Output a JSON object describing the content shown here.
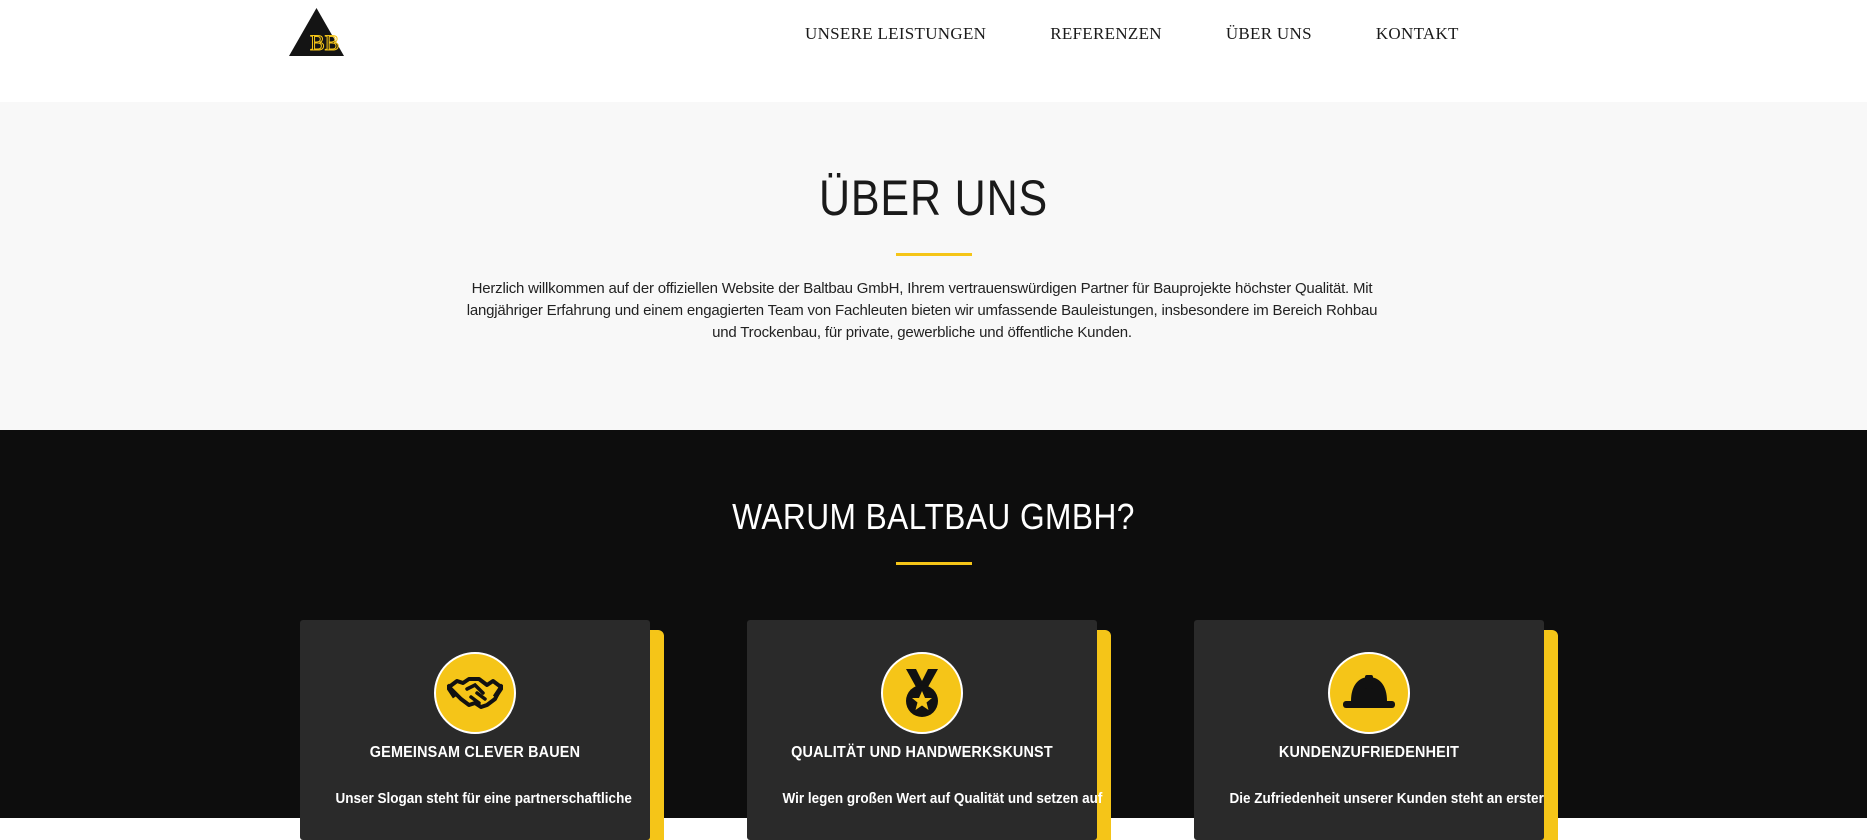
{
  "header": {
    "logo_label": "BB",
    "nav": [
      {
        "label": "UNSERE LEISTUNGEN"
      },
      {
        "label": "REFERENZEN"
      },
      {
        "label": "ÜBER UNS"
      },
      {
        "label": "KONTAKT"
      }
    ]
  },
  "about": {
    "title": "ÜBER UNS",
    "text": "Herzlich willkommen auf der offiziellen Website der Baltbau GmbH, Ihrem vertrauenswürdigen Partner für Bauprojekte höchster Qualität. Mit langjähriger Erfahrung und einem engagierten Team von Fachleuten bieten wir umfassende Bauleistungen, insbesondere im Bereich Rohbau und Trockenbau, für private, gewerbliche und öffentliche Kunden."
  },
  "why": {
    "title": "WARUM BALTBAU GMBH?",
    "cards": [
      {
        "icon": "handshake-icon",
        "title": "GEMEINSAM CLEVER BAUEN",
        "text": "Unser Slogan steht für eine partnerschaftliche"
      },
      {
        "icon": "medal-icon",
        "title": "QUALITÄT UND HANDWERKSKUNST",
        "text": "Wir legen großen Wert auf Qualität und setzen auf"
      },
      {
        "icon": "hardhat-icon",
        "title": "KUNDENZUFRIEDENHEIT",
        "text": "Die Zufriedenheit unserer Kunden steht an erster"
      }
    ]
  },
  "colors": {
    "accent": "#f5c518",
    "dark_bg": "#0d0d0d",
    "card_bg": "#2a2a2a",
    "light_bg": "#f8f8f8"
  }
}
